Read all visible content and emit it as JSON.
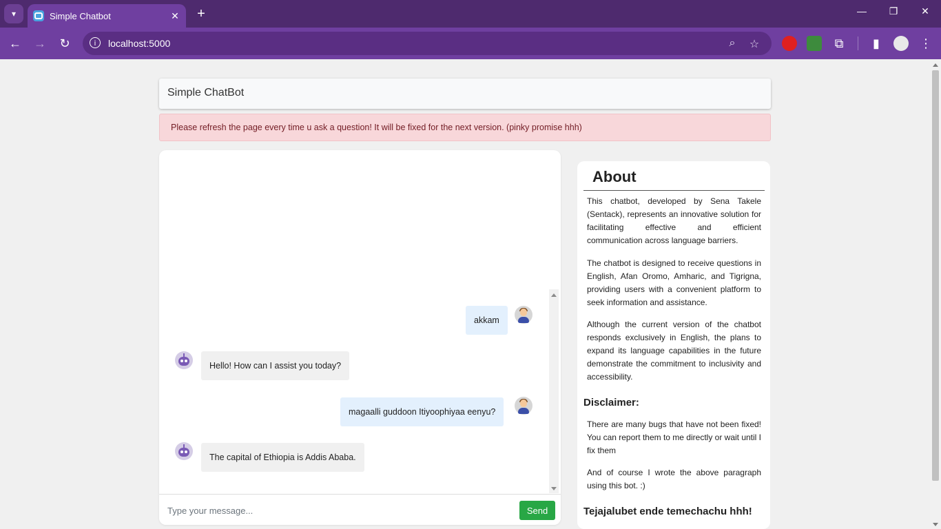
{
  "browser": {
    "tab_title": "Simple Chatbot",
    "tab_close": "✕",
    "new_tab": "+",
    "url": "localhost:5000"
  },
  "app": {
    "header_title": "Simple ChatBot",
    "alert_text": "Please refresh the page every time u ask a question! It will be fixed for the next version. (pinky promise hhh)"
  },
  "chat": {
    "messages": [
      {
        "sender": "user",
        "text": "akkam"
      },
      {
        "sender": "bot",
        "text": "Hello! How can I assist you today?"
      },
      {
        "sender": "user",
        "text": "magaalli guddoon Itiyoophiyaa eenyu?"
      },
      {
        "sender": "bot",
        "text": "The capital of Ethiopia is Addis Ababa."
      }
    ],
    "input_placeholder": "Type your message...",
    "send_label": "Send"
  },
  "about": {
    "title": "About",
    "paragraphs": [
      "This chatbot, developed by Sena Takele (Sentack), represents an innovative solution for facilitating effective and efficient communication across language barriers.",
      "The chatbot is designed to receive questions in English, Afan Oromo, Amharic, and Tigrigna, providing users with a convenient platform to seek information and assistance.",
      "Although the current version of the chatbot responds exclusively in English, the plans to expand its language capabilities in the future demonstrate the commitment to inclusivity and accessibility."
    ],
    "disclaimer_title": "Disclaimer:",
    "disclaimer_paragraphs": [
      "There are many bugs that have not been fixed! You can report them to me directly or wait until I fix them",
      "And of course I wrote the above paragraph using this bot. :)"
    ],
    "footer": "Tejajalubet ende temechachu hhh!"
  },
  "colors": {
    "chrome_dark": "#4e2a6e",
    "chrome": "#6f3fa0",
    "send_button": "#28a745",
    "alert_bg": "#f8d7da"
  }
}
